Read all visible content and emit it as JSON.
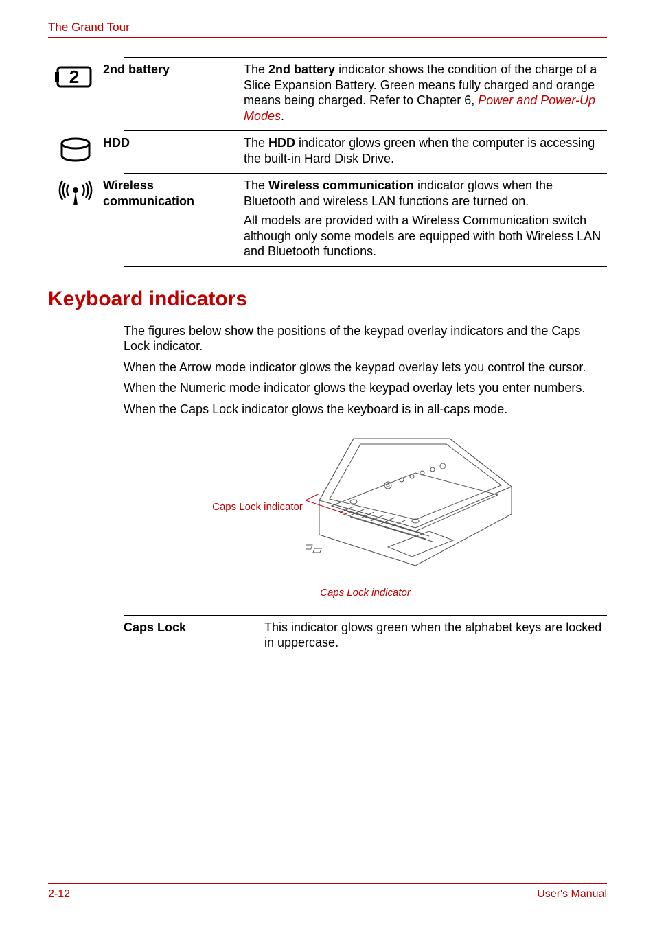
{
  "header": {
    "title": "The Grand Tour"
  },
  "rows": [
    {
      "term": "2nd battery",
      "desc1a": "The ",
      "desc1b": "2nd battery",
      "desc1c": " indicator shows the condition of the charge of a Slice Expansion Battery. Green means fully charged and orange means being charged. Refer to Chapter 6, ",
      "desc1link": "Power and Power-Up Modes",
      "desc1d": "."
    },
    {
      "term": "HDD",
      "desc1a": "The ",
      "desc1b": "HDD",
      "desc1c": " indicator glows green when the computer is accessing the built-in Hard Disk Drive."
    },
    {
      "term": "Wireless communication",
      "desc1a": "The ",
      "desc1b": "Wireless communication",
      "desc1c": " indicator glows when the Bluetooth and wireless LAN functions are turned on.",
      "desc2": "All models are provided with a Wireless Communication switch although only some models are equipped with both Wireless LAN and Bluetooth functions."
    }
  ],
  "section": {
    "heading": "Keyboard indicators"
  },
  "body": {
    "p1": "The figures below show the positions of the keypad overlay indicators and the Caps Lock indicator.",
    "p2": "When the Arrow mode indicator glows the keypad overlay lets you control the cursor.",
    "p3": "When the Numeric mode indicator glows the keypad overlay lets you enter numbers.",
    "p4": "When the Caps Lock indicator glows the keyboard is in all-caps mode."
  },
  "figure": {
    "callout": "Caps Lock indicator",
    "caption": "Caps Lock indicator"
  },
  "table2": {
    "term": "Caps Lock",
    "desc": "This indicator glows green when the alphabet keys are locked in uppercase."
  },
  "footer": {
    "page": "2-12",
    "label": "User's Manual"
  }
}
